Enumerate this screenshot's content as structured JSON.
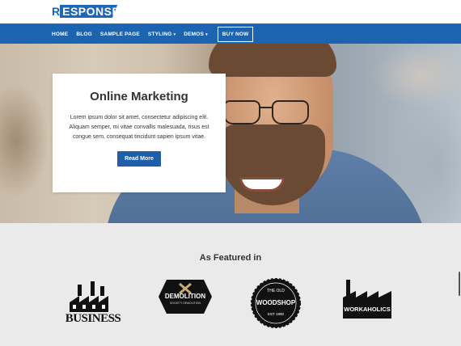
{
  "header": {
    "logo_first": "R",
    "logo_rest": "ESPONSE"
  },
  "nav": {
    "items": [
      {
        "label": "HOME"
      },
      {
        "label": "BLOG"
      },
      {
        "label": "SAMPLE PAGE"
      },
      {
        "label": "STYLING",
        "caret": "▾"
      },
      {
        "label": "DEMOS",
        "caret": "▾"
      }
    ],
    "buy_label": "BUY NOW"
  },
  "hero": {
    "title": "Online Marketing",
    "text": "Lorem ipsum dolor sit amet, consectetur adipiscing elit. Aliquam semper, mi vitae convallis malesuada, risus est congue sem, consequat tincidunt sapien ipsum vitae.",
    "button_label": "Read More"
  },
  "featured": {
    "title": "As Featured in",
    "brands": [
      {
        "name": "BUSINESS"
      },
      {
        "name": "DEMOLITION",
        "sub": "SOCIETY DEMOLITION"
      },
      {
        "name": "WOODSHOP",
        "top": "THE OLD",
        "bottom": "EST 1990"
      },
      {
        "name": "WORKAHOLICS"
      }
    ]
  },
  "colors": {
    "brand_blue": "#1d64b0",
    "button_blue": "#1f5ea8",
    "featured_bg": "#eaeaea"
  }
}
